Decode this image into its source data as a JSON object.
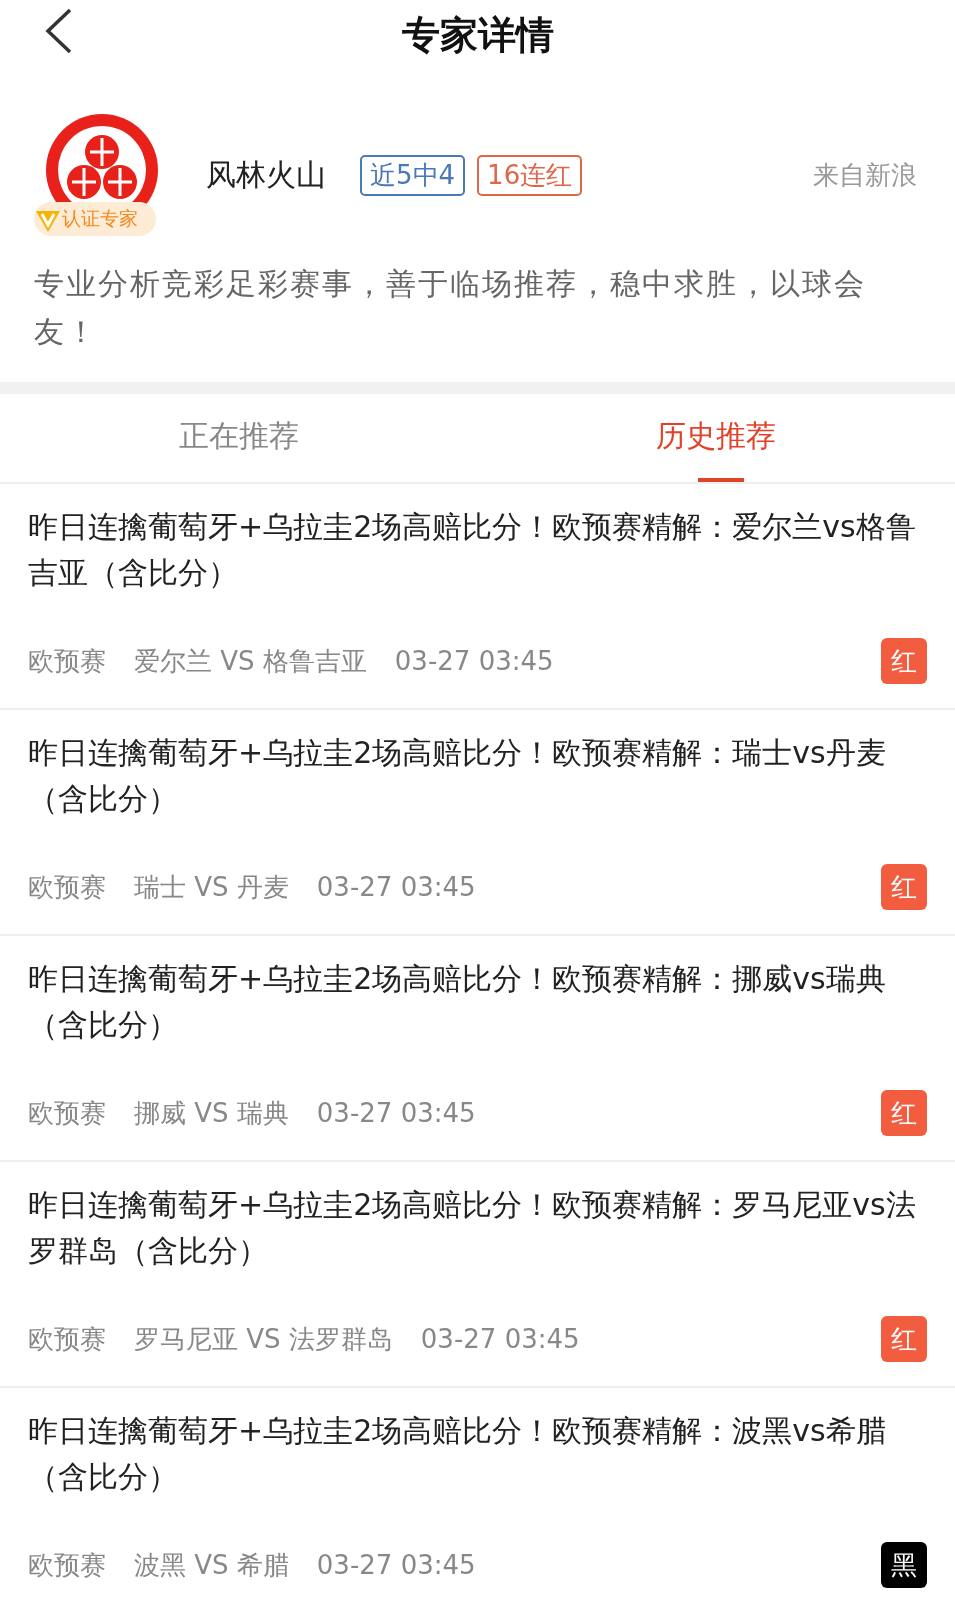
{
  "header": {
    "title": "专家详情"
  },
  "expert": {
    "name": "风林火山",
    "verified_label": "认证专家",
    "tags": [
      {
        "text": "近5中4",
        "color": "#4a78b8"
      },
      {
        "text": "16连红",
        "color": "#e0664a"
      }
    ],
    "source": "来自新浪",
    "bio": "专业分析竞彩足彩赛事，善于临场推荐，稳中求胜，以球会友！"
  },
  "tabs": [
    {
      "label": "正在推荐",
      "selected": false
    },
    {
      "label": "历史推荐",
      "selected": true
    }
  ],
  "items": [
    {
      "title": "昨日连擒葡萄牙+乌拉圭2场高赔比分！欧预赛精解：爱尔兰vs格鲁吉亚（含比分）",
      "league": "欧预赛",
      "match": "爱尔兰 VS 格鲁吉亚",
      "time": "03-27 03:45",
      "result": "红",
      "color": "#f25c3f"
    },
    {
      "title": "昨日连擒葡萄牙+乌拉圭2场高赔比分！欧预赛精解：瑞士vs丹麦（含比分）",
      "league": "欧预赛",
      "match": "瑞士 VS 丹麦",
      "time": "03-27 03:45",
      "result": "红",
      "color": "#f25c3f"
    },
    {
      "title": "昨日连擒葡萄牙+乌拉圭2场高赔比分！欧预赛精解：挪威vs瑞典（含比分）",
      "league": "欧预赛",
      "match": "挪威 VS 瑞典",
      "time": "03-27 03:45",
      "result": "红",
      "color": "#f25c3f"
    },
    {
      "title": "昨日连擒葡萄牙+乌拉圭2场高赔比分！欧预赛精解：罗马尼亚vs法罗群岛（含比分）",
      "league": "欧预赛",
      "match": "罗马尼亚 VS 法罗群岛",
      "time": "03-27 03:45",
      "result": "红",
      "color": "#f25c3f"
    },
    {
      "title": "昨日连擒葡萄牙+乌拉圭2场高赔比分！欧预赛精解：波黑vs希腊（含比分）",
      "league": "欧预赛",
      "match": "波黑 VS 希腊",
      "time": "03-27 03:45",
      "result": "黑",
      "color": "#000000"
    }
  ]
}
